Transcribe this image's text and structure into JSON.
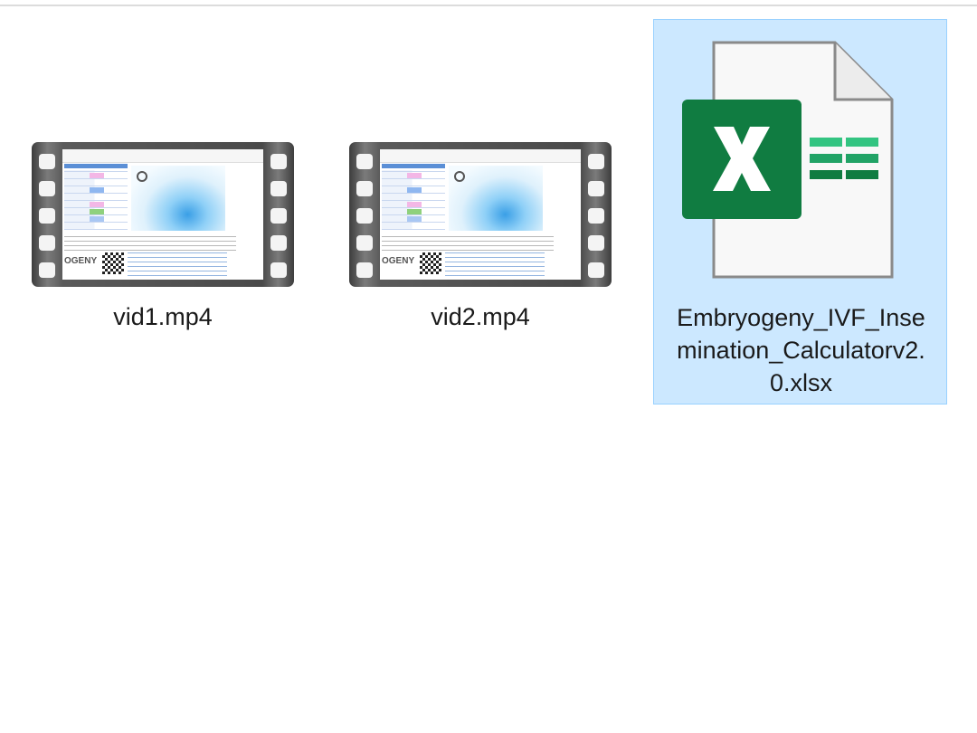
{
  "files": [
    {
      "name": "vid1.mp4",
      "type": "video",
      "icon": "film-strip-icon",
      "selected": false
    },
    {
      "name": "vid2.mp4",
      "type": "video",
      "icon": "film-strip-icon",
      "selected": false
    },
    {
      "name_lines": [
        "Embryogeny_IVF_Inse",
        "mination_Calculatorv2.",
        "0.xlsx"
      ],
      "type": "excel",
      "icon": "excel-file-icon",
      "selected": true
    }
  ],
  "thumbnail": {
    "logo_text": "OGENY"
  },
  "colors": {
    "selection_bg": "#cce8ff",
    "selection_border": "#99d1ff",
    "excel_green": "#107c41"
  }
}
